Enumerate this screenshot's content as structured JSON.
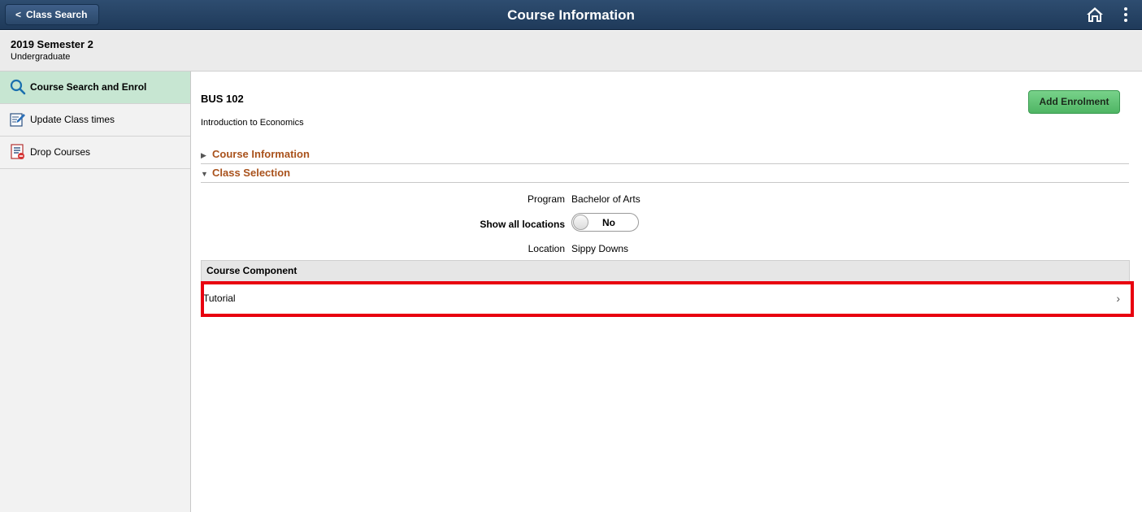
{
  "header": {
    "back_label": "Class Search",
    "title": "Course Information",
    "home_icon": "home-icon",
    "more_icon": "more-vertical-icon"
  },
  "context": {
    "term": "2019 Semester 2",
    "career": "Undergraduate"
  },
  "sidebar": {
    "items": [
      {
        "label": "Course Search and Enrol",
        "icon": "search-icon",
        "active": true
      },
      {
        "label": "Update Class times",
        "icon": "edit-icon",
        "active": false
      },
      {
        "label": "Drop Courses",
        "icon": "drop-list-icon",
        "active": false
      }
    ]
  },
  "course": {
    "code": "BUS 102",
    "title": "Introduction to Economics",
    "add_button": "Add Enrolment"
  },
  "sections": {
    "course_info": "Course Information",
    "class_selection": "Class Selection"
  },
  "fields": {
    "program_label": "Program",
    "program_value": "Bachelor of Arts",
    "show_all_label": "Show all locations",
    "show_all_value": "No",
    "location_label": "Location",
    "location_value": "Sippy Downs"
  },
  "component_grid": {
    "header": "Course Component",
    "rows": [
      {
        "label": "Tutorial"
      }
    ]
  },
  "colors": {
    "header_bg": "#254468",
    "active_nav": "#c7e6d2",
    "section_text": "#a9521c",
    "add_button": "#5cbf71",
    "highlight_border": "#e8000f"
  }
}
